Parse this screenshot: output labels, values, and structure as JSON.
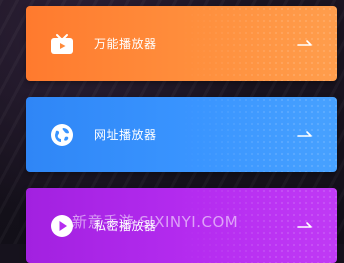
{
  "players": [
    {
      "label": "万能播放器",
      "icon": "tv-icon",
      "color": "#ff8a3a"
    },
    {
      "label": "网址播放器",
      "icon": "globe-icon",
      "color": "#3a95ff"
    },
    {
      "label": "私密播放器",
      "icon": "play-icon",
      "color": "#b52cf0"
    }
  ],
  "watermark": "新意手游 SJXINYI.COM"
}
